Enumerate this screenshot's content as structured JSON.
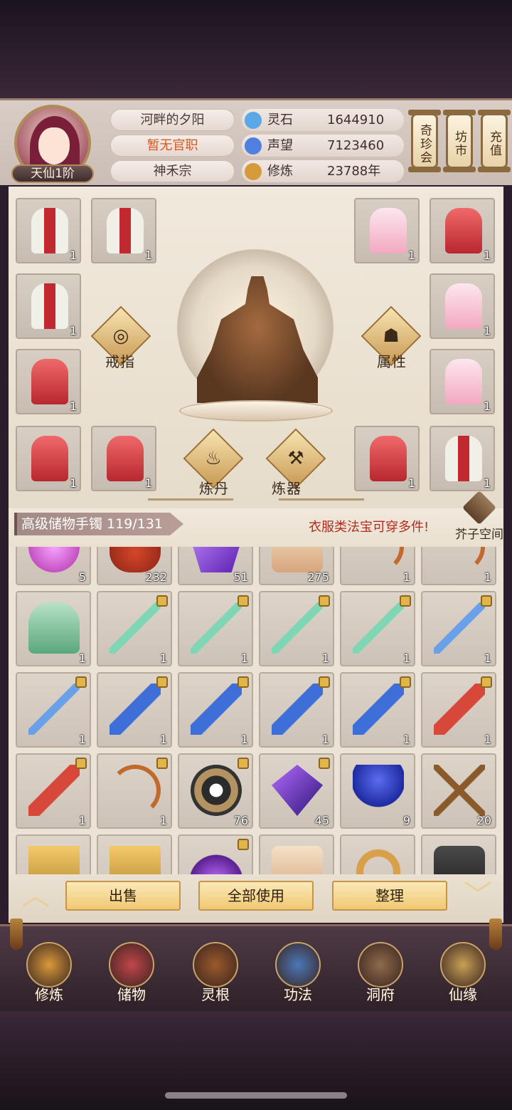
{
  "header": {
    "rank": "天仙1阶",
    "name": "河畔的夕阳",
    "official": "暂无官职",
    "sect": "神禾宗",
    "resources": [
      {
        "icon": "spirit-stone-icon",
        "label": "灵石",
        "value": "1644910",
        "color": "#5aa8e8"
      },
      {
        "icon": "reputation-crystal-icon",
        "label": "声望",
        "value": "7123460",
        "color": "#4f7fe0"
      },
      {
        "icon": "cultivation-icon",
        "label": "修炼",
        "value": "23788年",
        "color": "#d49a3c"
      }
    ],
    "scroll_buttons": [
      "奇珍会",
      "坊市",
      "充值"
    ]
  },
  "equip": {
    "left_slots": [
      {
        "robe": "mixed",
        "count": "1"
      },
      {
        "robe": "mixed",
        "count": "1"
      },
      {
        "robe": "mixed",
        "count": "1"
      },
      {
        "robe": "red",
        "count": "1"
      },
      {
        "robe": "red",
        "count": "1"
      },
      {
        "robe": "red",
        "count": "1"
      }
    ],
    "right_slots": [
      {
        "robe": "pink",
        "count": "1"
      },
      {
        "robe": "red",
        "count": "1"
      },
      {
        "robe": "pink",
        "count": "1"
      },
      {
        "robe": "pink",
        "count": "1"
      },
      {
        "robe": "red",
        "count": "1"
      },
      {
        "robe": "mixed",
        "count": "1"
      }
    ],
    "ring_label": "戒指",
    "attr_label": "属性",
    "alchemy_label": "炼丹",
    "forge_label": "炼器"
  },
  "bag": {
    "tab_label": "高级储物手镯 119/131",
    "tip": "衣服类法宝可穿多件!",
    "space_label": "芥子空间"
  },
  "inventory": [
    {
      "art": "pink",
      "count": "5",
      "locked": false
    },
    {
      "art": "bowl",
      "count": "232",
      "locked": false
    },
    {
      "art": "crystal",
      "count": "51",
      "locked": false
    },
    {
      "art": "scroll",
      "count": "275",
      "locked": false
    },
    {
      "art": "bow",
      "count": "1",
      "locked": false
    },
    {
      "art": "bow",
      "count": "1",
      "locked": false
    },
    {
      "art": "robe-green",
      "count": "1",
      "locked": false
    },
    {
      "art": "sword",
      "count": "1",
      "locked": true
    },
    {
      "art": "sword",
      "count": "1",
      "locked": true
    },
    {
      "art": "sword",
      "count": "1",
      "locked": true
    },
    {
      "art": "sword",
      "count": "1",
      "locked": true
    },
    {
      "art": "sword-blue",
      "count": "1",
      "locked": true
    },
    {
      "art": "sword-blue",
      "count": "1",
      "locked": true
    },
    {
      "art": "blade-blue",
      "count": "1",
      "locked": true
    },
    {
      "art": "blade-blue",
      "count": "1",
      "locked": true
    },
    {
      "art": "blade-blue",
      "count": "1",
      "locked": true
    },
    {
      "art": "blade-blue",
      "count": "1",
      "locked": true
    },
    {
      "art": "blade-red",
      "count": "1",
      "locked": true
    },
    {
      "art": "blade-red",
      "count": "1",
      "locked": true
    },
    {
      "art": "bow",
      "count": "1",
      "locked": true
    },
    {
      "art": "taiji",
      "count": "76",
      "locked": true
    },
    {
      "art": "gem",
      "count": "45",
      "locked": true
    },
    {
      "art": "plant",
      "count": "9",
      "locked": false
    },
    {
      "art": "sticks",
      "count": "20",
      "locked": false
    },
    {
      "art": "talisman",
      "count": "",
      "locked": false
    },
    {
      "art": "talisman",
      "count": "",
      "locked": false
    },
    {
      "art": "flame",
      "count": "",
      "locked": true
    },
    {
      "art": "scroll",
      "count": "",
      "locked": false
    },
    {
      "art": "ring",
      "count": "",
      "locked": false
    },
    {
      "art": "stone",
      "count": "",
      "locked": false
    }
  ],
  "actions": {
    "sell": "出售",
    "use_all": "全部使用",
    "sort": "整理"
  },
  "nav": [
    {
      "label": "修炼",
      "icon": "cultivate-icon",
      "color": "#d99a3a"
    },
    {
      "label": "储物",
      "icon": "storage-bag-icon",
      "color": "#c2454a"
    },
    {
      "label": "灵根",
      "icon": "spirit-root-icon",
      "color": "#9b5a2a"
    },
    {
      "label": "功法",
      "icon": "technique-book-icon",
      "color": "#4a78b8"
    },
    {
      "label": "洞府",
      "icon": "cave-dwelling-icon",
      "color": "#8e6b4a"
    },
    {
      "label": "仙缘",
      "icon": "immortal-fate-icon",
      "color": "#c7a055"
    }
  ]
}
